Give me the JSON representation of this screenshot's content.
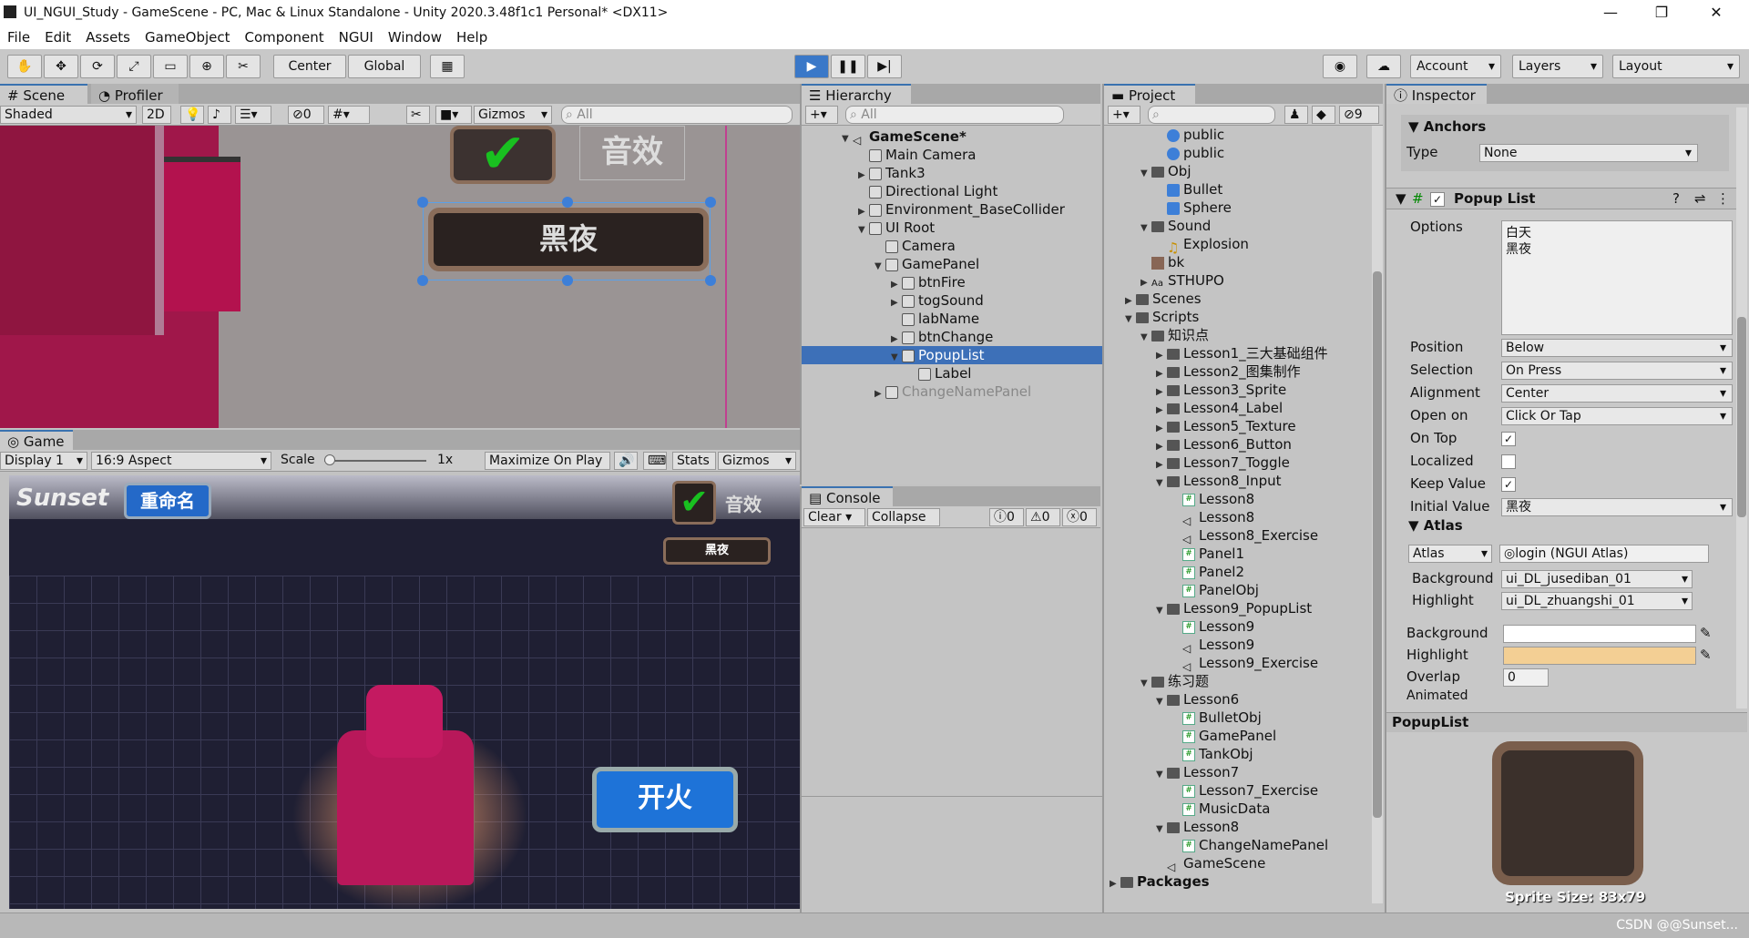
{
  "window": {
    "title": "UI_NGUI_Study - GameScene - PC, Mac & Linux Standalone - Unity 2020.3.48f1c1 Personal* <DX11>",
    "min": "—",
    "max": "❐",
    "close": "✕"
  },
  "menu": [
    "File",
    "Edit",
    "Assets",
    "GameObject",
    "Component",
    "NGUI",
    "Window",
    "Help"
  ],
  "toolbar": {
    "center": "Center",
    "global": "Global",
    "account": "Account",
    "layers": "Layers",
    "layout": "Layout"
  },
  "scene": {
    "tab": "Scene",
    "tab2": "Profiler",
    "shading": "Shaded",
    "twod": "2D",
    "hidden": "0",
    "gizmos": "Gizmos",
    "search": "All",
    "popup_text": "黑夜",
    "sound_text": "音效"
  },
  "game": {
    "tab": "Game",
    "display": "Display 1",
    "aspect": "16:9 Aspect",
    "scale_label": "Scale",
    "scale_val": "1x",
    "maximize": "Maximize On Play",
    "stats": "Stats",
    "gizmos": "Gizmos",
    "logo": "Sunset",
    "rename": "重命名",
    "sound": "音效",
    "night": "黑夜",
    "fire": "开火"
  },
  "hierarchy": {
    "tab": "Hierarchy",
    "search": "All",
    "items": [
      {
        "label": "GameScene*",
        "indent": 0,
        "arrow": "▼",
        "bold": true,
        "icon": "unity-icon"
      },
      {
        "label": "Main Camera",
        "indent": 1,
        "arrow": "",
        "icon": "cube-icon"
      },
      {
        "label": "Tank3",
        "indent": 1,
        "arrow": "▶",
        "icon": "cube-icon"
      },
      {
        "label": "Directional Light",
        "indent": 1,
        "arrow": "",
        "icon": "cube-icon"
      },
      {
        "label": "Environment_BaseCollider",
        "indent": 1,
        "arrow": "▶",
        "icon": "cube-icon"
      },
      {
        "label": "UI Root",
        "indent": 1,
        "arrow": "▼",
        "icon": "cube-icon"
      },
      {
        "label": "Camera",
        "indent": 2,
        "arrow": "",
        "icon": "cube-icon"
      },
      {
        "label": "GamePanel",
        "indent": 2,
        "arrow": "▼",
        "icon": "cube-icon"
      },
      {
        "label": "btnFire",
        "indent": 3,
        "arrow": "▶",
        "icon": "cube-icon"
      },
      {
        "label": "togSound",
        "indent": 3,
        "arrow": "▶",
        "icon": "cube-icon"
      },
      {
        "label": "labName",
        "indent": 3,
        "arrow": "",
        "icon": "cube-icon"
      },
      {
        "label": "btnChange",
        "indent": 3,
        "arrow": "▶",
        "icon": "cube-icon"
      },
      {
        "label": "PopupList",
        "indent": 3,
        "arrow": "▼",
        "icon": "cube-icon",
        "selected": true
      },
      {
        "label": "Label",
        "indent": 4,
        "arrow": "",
        "icon": "cube-icon"
      },
      {
        "label": "ChangeNamePanel",
        "indent": 2,
        "arrow": "▶",
        "icon": "cube-icon",
        "disabled": true
      }
    ]
  },
  "console": {
    "tab": "Console",
    "clear": "Clear",
    "collapse": "Collapse",
    "c1": "0",
    "c2": "0",
    "c3": "0"
  },
  "project": {
    "tab": "Project",
    "count": "9",
    "items": [
      {
        "label": "public",
        "indent": 3,
        "arrow": "",
        "icon": "sphere-icon"
      },
      {
        "label": "public",
        "indent": 3,
        "arrow": "",
        "icon": "sphere-icon"
      },
      {
        "label": "Obj",
        "indent": 2,
        "arrow": "▼",
        "icon": "folder-icon"
      },
      {
        "label": "Bullet",
        "indent": 3,
        "arrow": "",
        "icon": "prefab-icon"
      },
      {
        "label": "Sphere",
        "indent": 3,
        "arrow": "",
        "icon": "prefab-icon"
      },
      {
        "label": "Sound",
        "indent": 2,
        "arrow": "▼",
        "icon": "folder-icon"
      },
      {
        "label": "Explosion",
        "indent": 3,
        "arrow": "",
        "icon": "audio-icon"
      },
      {
        "label": "bk",
        "indent": 2,
        "arrow": "",
        "icon": "image-icon"
      },
      {
        "label": "STHUPO",
        "indent": 2,
        "arrow": "▶",
        "icon": "font-icon"
      },
      {
        "label": "Scenes",
        "indent": 1,
        "arrow": "▶",
        "icon": "folder-icon"
      },
      {
        "label": "Scripts",
        "indent": 1,
        "arrow": "▼",
        "icon": "folder-icon"
      },
      {
        "label": "知识点",
        "indent": 2,
        "arrow": "▼",
        "icon": "folder-icon"
      },
      {
        "label": "Lesson1_三大基础组件",
        "indent": 3,
        "arrow": "▶",
        "icon": "folder-icon"
      },
      {
        "label": "Lesson2_图集制作",
        "indent": 3,
        "arrow": "▶",
        "icon": "folder-icon"
      },
      {
        "label": "Lesson3_Sprite",
        "indent": 3,
        "arrow": "▶",
        "icon": "folder-icon"
      },
      {
        "label": "Lesson4_Label",
        "indent": 3,
        "arrow": "▶",
        "icon": "folder-icon"
      },
      {
        "label": "Lesson5_Texture",
        "indent": 3,
        "arrow": "▶",
        "icon": "folder-icon"
      },
      {
        "label": "Lesson6_Button",
        "indent": 3,
        "arrow": "▶",
        "icon": "folder-icon"
      },
      {
        "label": "Lesson7_Toggle",
        "indent": 3,
        "arrow": "▶",
        "icon": "folder-icon"
      },
      {
        "label": "Lesson8_Input",
        "indent": 3,
        "arrow": "▼",
        "icon": "folder-icon"
      },
      {
        "label": "Lesson8",
        "indent": 4,
        "arrow": "",
        "icon": "script-icon"
      },
      {
        "label": "Lesson8",
        "indent": 4,
        "arrow": "",
        "icon": "scene-icon"
      },
      {
        "label": "Lesson8_Exercise",
        "indent": 4,
        "arrow": "",
        "icon": "scene-icon"
      },
      {
        "label": "Panel1",
        "indent": 4,
        "arrow": "",
        "icon": "script-icon"
      },
      {
        "label": "Panel2",
        "indent": 4,
        "arrow": "",
        "icon": "script-icon"
      },
      {
        "label": "PanelObj",
        "indent": 4,
        "arrow": "",
        "icon": "script-icon"
      },
      {
        "label": "Lesson9_PopupList",
        "indent": 3,
        "arrow": "▼",
        "icon": "folder-icon"
      },
      {
        "label": "Lesson9",
        "indent": 4,
        "arrow": "",
        "icon": "script-icon"
      },
      {
        "label": "Lesson9",
        "indent": 4,
        "arrow": "",
        "icon": "scene-icon"
      },
      {
        "label": "Lesson9_Exercise",
        "indent": 4,
        "arrow": "",
        "icon": "scene-icon"
      },
      {
        "label": "练习题",
        "indent": 2,
        "arrow": "▼",
        "icon": "folder-icon"
      },
      {
        "label": "Lesson6",
        "indent": 3,
        "arrow": "▼",
        "icon": "folder-icon"
      },
      {
        "label": "BulletObj",
        "indent": 4,
        "arrow": "",
        "icon": "script-icon"
      },
      {
        "label": "GamePanel",
        "indent": 4,
        "arrow": "",
        "icon": "script-icon"
      },
      {
        "label": "TankObj",
        "indent": 4,
        "arrow": "",
        "icon": "script-icon"
      },
      {
        "label": "Lesson7",
        "indent": 3,
        "arrow": "▼",
        "icon": "folder-icon"
      },
      {
        "label": "Lesson7_Exercise",
        "indent": 4,
        "arrow": "",
        "icon": "script-icon"
      },
      {
        "label": "MusicData",
        "indent": 4,
        "arrow": "",
        "icon": "script-icon"
      },
      {
        "label": "Lesson8",
        "indent": 3,
        "arrow": "▼",
        "icon": "folder-icon"
      },
      {
        "label": "ChangeNamePanel",
        "indent": 4,
        "arrow": "",
        "icon": "script-icon"
      },
      {
        "label": "GameScene",
        "indent": 3,
        "arrow": "",
        "icon": "scene-icon"
      },
      {
        "label": "Packages",
        "indent": 0,
        "arrow": "▶",
        "icon": "folder-icon",
        "bold": true
      }
    ]
  },
  "inspector": {
    "tab": "Inspector",
    "anchors": "Anchors",
    "type_label": "Type",
    "type_val": "None",
    "component": "Popup List",
    "options_label": "Options",
    "options": [
      "白天",
      "黑夜"
    ],
    "props": [
      {
        "label": "Position",
        "value": "Below",
        "kind": "drop"
      },
      {
        "label": "Selection",
        "value": "On Press",
        "kind": "drop"
      },
      {
        "label": "Alignment",
        "value": "Center",
        "kind": "drop"
      },
      {
        "label": "Open on",
        "value": "Click Or Tap",
        "kind": "drop"
      },
      {
        "label": "On Top",
        "value": "✓",
        "kind": "check"
      },
      {
        "label": "Localized",
        "value": "",
        "kind": "check"
      },
      {
        "label": "Keep Value",
        "value": "✓",
        "kind": "check"
      },
      {
        "label": "Initial Value",
        "value": "黑夜",
        "kind": "drop"
      }
    ],
    "atlas_header": "Atlas",
    "atlas_drop": "Atlas",
    "atlas_val": "login (NGUI Atlas)",
    "bg_label": "Background",
    "bg_val": "ui_DL_jusediban_01",
    "hl_label": "Highlight",
    "hl_val": "ui_DL_zhuangshi_01",
    "bg2_label": "Background",
    "hl2_label": "Highlight",
    "bg_color": "#ffffff",
    "hl_color": "#f3cf94",
    "overlap_label": "Overlap",
    "overlap_val": "0",
    "animated_label": "Animated",
    "preview_title": "PopupList",
    "sprite_size": "Sprite Size: 83x79"
  },
  "watermark": "CSDN @@Sunset..."
}
